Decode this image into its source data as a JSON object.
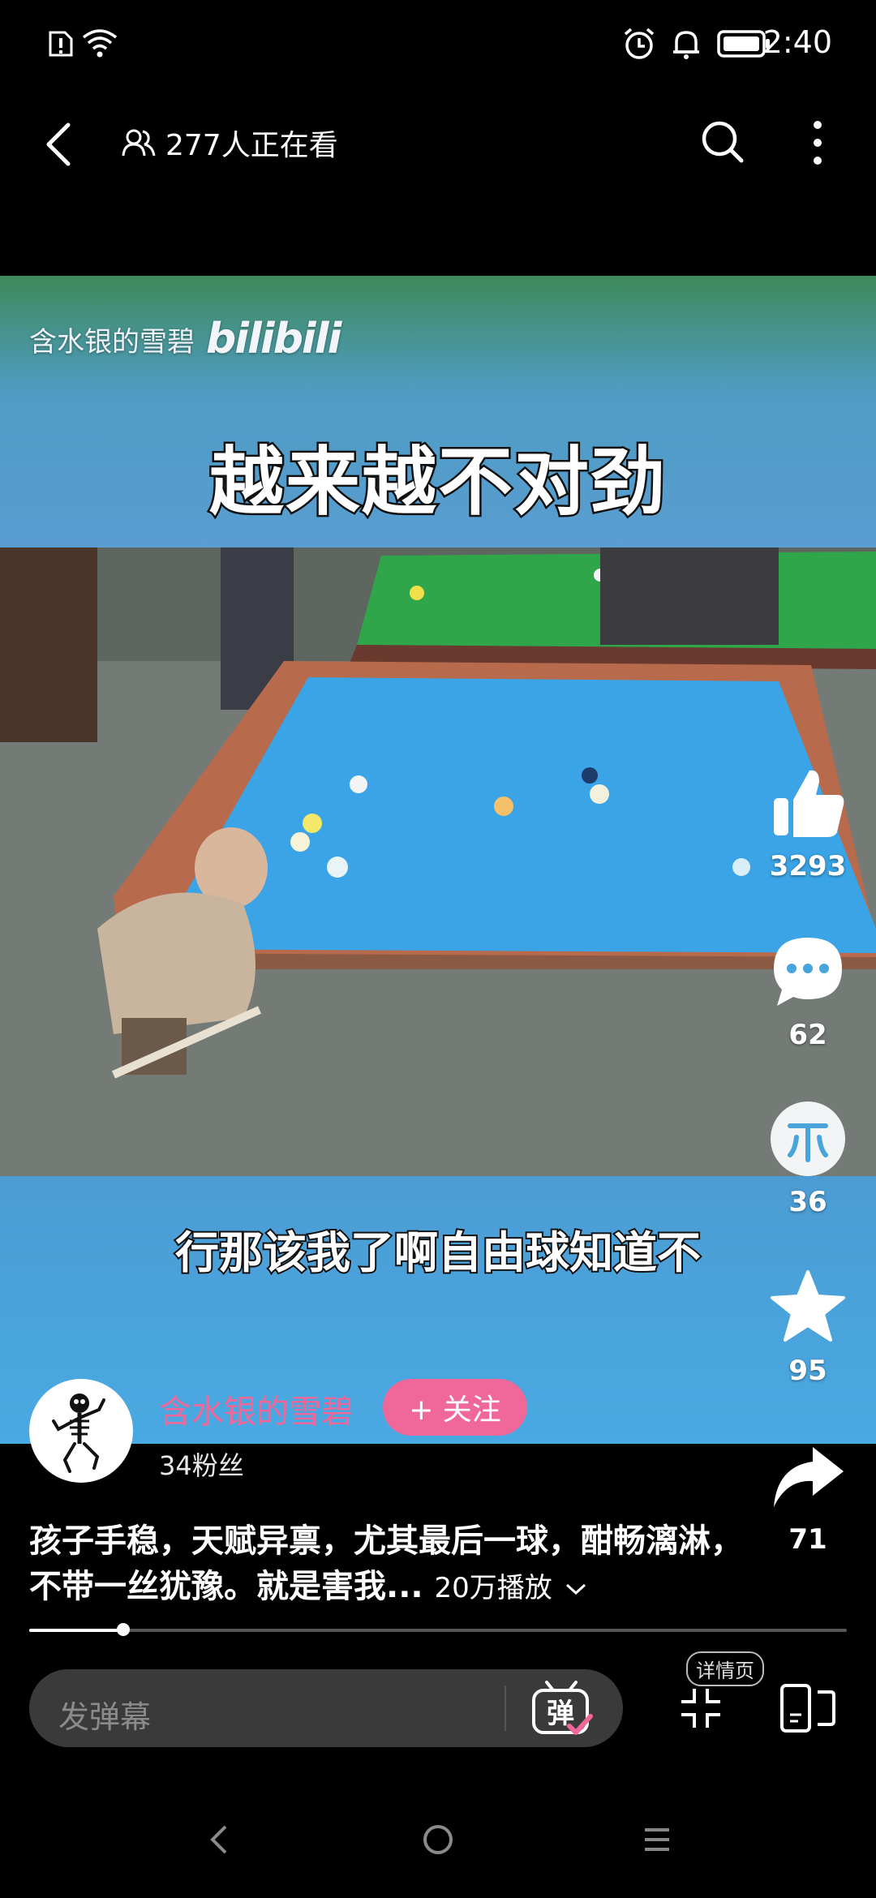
{
  "status_bar": {
    "time": "2:40",
    "icons": [
      "sim-alert-icon",
      "wifi-icon",
      "alarm-icon",
      "bell-icon",
      "battery-icon"
    ]
  },
  "top_nav": {
    "viewers_text": "277人正在看",
    "icons": [
      "back-icon",
      "people-icon",
      "search-icon",
      "more-icon"
    ]
  },
  "video": {
    "watermark_author": "含水银的雪碧",
    "watermark_brand": "bilibili",
    "caption_top": "越来越不对劲",
    "caption_bottom": "行那该我了啊自由球知道不"
  },
  "actions": {
    "like_count": "3293",
    "comment_count": "62",
    "coin_count": "36",
    "favorite_count": "95",
    "share_count": "71"
  },
  "author": {
    "name": "含水银的雪碧",
    "follow_label": "+ 关注",
    "fans": "34粉丝"
  },
  "description": {
    "text": "孩子手稳，天赋异禀，尤其最后一球，酣畅漓淋，不带一丝犹豫。就是害我...",
    "plays": "20万播放"
  },
  "progress": {
    "fraction": 0.115
  },
  "danmaku": {
    "placeholder": "发弹幕",
    "button_glyph": "弹",
    "detail_badge": "详情页"
  },
  "colors": {
    "accent_pink": "#f0679a",
    "table_blue": "#3aa4e6",
    "table_green": "#33b24a"
  }
}
